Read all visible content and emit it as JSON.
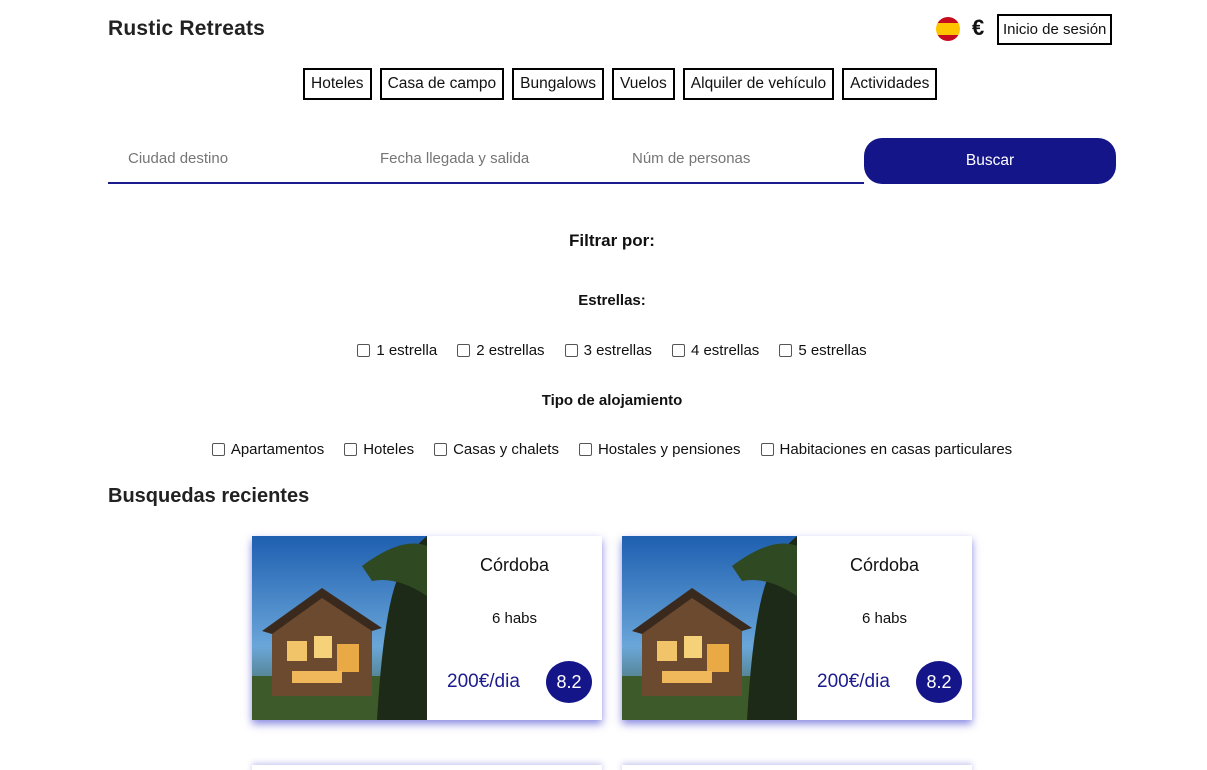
{
  "header": {
    "logo": "Rustic Retreats",
    "currency_symbol": "€",
    "login_label": "Inicio de sesión",
    "language_icon": "spain-flag-icon"
  },
  "nav": {
    "items": [
      "Hoteles",
      "Casa de campo",
      "Bungalows",
      "Vuelos",
      "Alquiler de vehículo",
      "Actividades"
    ]
  },
  "search": {
    "destination_placeholder": "Ciudad destino",
    "dates_placeholder": "Fecha llegada y salida",
    "people_placeholder": "Núm de personas",
    "button_label": "Buscar"
  },
  "filters": {
    "title": "Filtrar por:",
    "stars_title": "Estrellas:",
    "stars": [
      "1 estrella",
      "2 estrellas",
      "3 estrellas",
      "4 estrellas",
      "5 estrellas"
    ],
    "type_title": "Tipo de alojamiento",
    "types": [
      "Apartamentos",
      "Hoteles",
      "Casas y chalets",
      "Hostales y pensiones",
      "Habitaciones en casas particulares"
    ]
  },
  "recent": {
    "title": "Busquedas recientes",
    "cards": [
      {
        "city": "Córdoba",
        "rooms": "6 habs",
        "price": "200€/dia",
        "score": "8.2"
      },
      {
        "city": "Córdoba",
        "rooms": "6 habs",
        "price": "200€/dia",
        "score": "8.2"
      }
    ]
  },
  "colors": {
    "accent": "#15158a",
    "shadow": "#2828c8"
  }
}
